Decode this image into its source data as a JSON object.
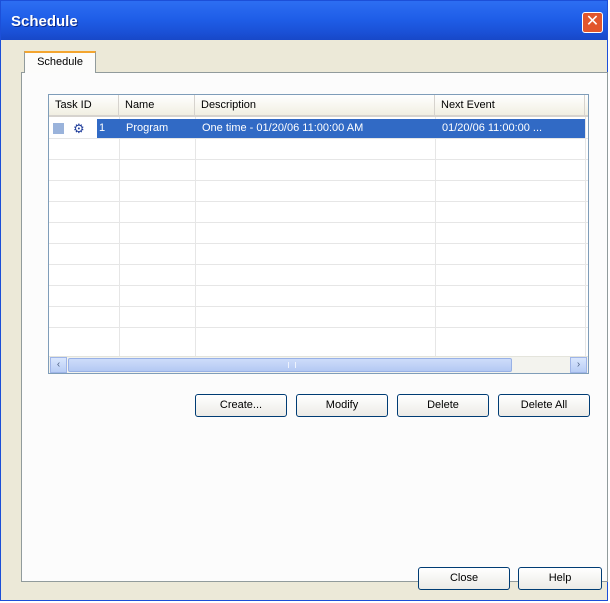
{
  "window": {
    "title": "Schedule",
    "close_glyph": "✕"
  },
  "tabs": [
    {
      "label": "Schedule"
    }
  ],
  "table": {
    "columns": [
      "Task ID",
      "Name",
      "Description",
      "Next Event"
    ],
    "rows": [
      {
        "task_id": "1",
        "name": "Program",
        "description": "One time - 01/20/06 11:00:00 AM",
        "next_event": "01/20/06 11:00:00 ..."
      }
    ],
    "selected_row": 0
  },
  "scrollbar": {
    "left_arrow": "‹",
    "right_arrow": "›"
  },
  "buttons": {
    "create": "Create...",
    "modify": "Modify",
    "delete": "Delete",
    "delete_all": "Delete All",
    "close": "Close",
    "help": "Help"
  },
  "icons": {
    "row_square": "square-icon",
    "row_task": "task-gear-icon"
  },
  "colors": {
    "titlebar": "#1f5ee8",
    "selection": "#316ac5",
    "tab_accent": "#f3a52f"
  }
}
